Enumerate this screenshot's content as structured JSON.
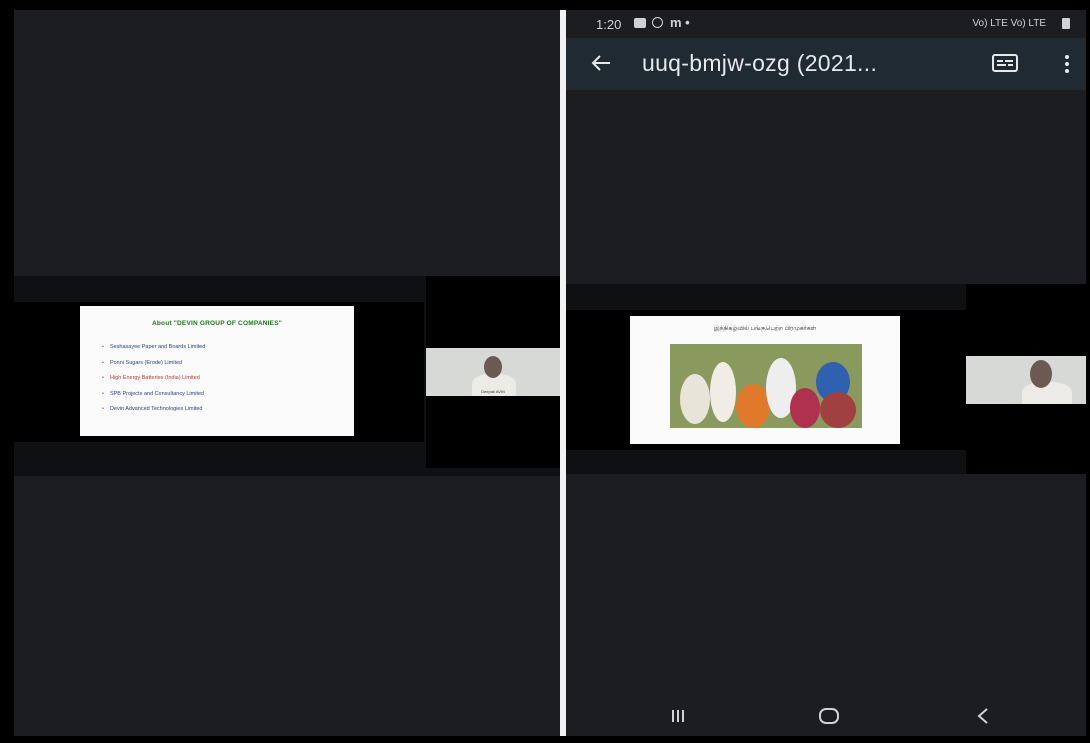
{
  "left_screen": {
    "slide": {
      "title": "About \"DEVIN GROUP OF COMPANIES\"",
      "items": [
        {
          "label": "Seshasayee Paper and Boards Limited",
          "color": "#2a3f8f"
        },
        {
          "label": "Ponni Sugars (Erode) Limited",
          "color": "#2a3f8f"
        },
        {
          "label": "High Energy Batteries (India) Limited",
          "color": "#c0392b"
        },
        {
          "label": "SPB Projects and Consultancy Limited",
          "color": "#2a3f8f"
        },
        {
          "label": "Devin Advanced Technologies Limited",
          "color": "#2a3f8f"
        }
      ]
    },
    "camera": {
      "participant_name": "Deepak AVIN"
    }
  },
  "right_screen": {
    "status_bar": {
      "time": "1:20",
      "indicators": "m  •",
      "signal": "Vo) LTE Vo) LTE"
    },
    "app_bar": {
      "title": "uuq-bmjw-ozg (2021...",
      "back_icon": "arrow-left-icon",
      "captions_icon": "closed-captions-icon",
      "menu_icon": "more-vert-icon"
    },
    "slide": {
      "title": "இந்நிகழ்வில் பங்குபெற்ற பிரமுகர்கள்"
    },
    "navigation": {
      "recents_icon": "recents-icon",
      "home_icon": "home-icon",
      "back_icon": "nav-back-icon"
    }
  },
  "colors": {
    "background": "#1c1d20",
    "app_bar": "#1f2a33",
    "slide_title_green": "#1a7a1a"
  }
}
